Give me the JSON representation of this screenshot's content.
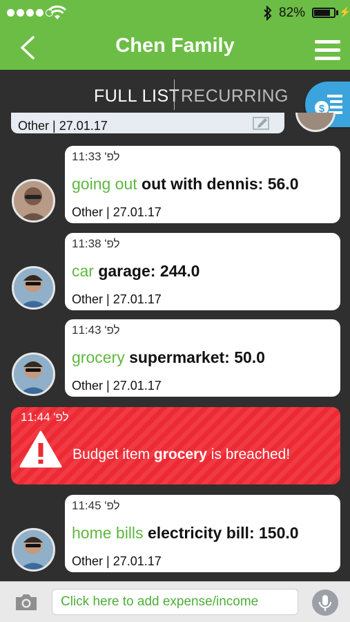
{
  "status_bar": {
    "battery": "82%",
    "battery_level": 0.82
  },
  "header": {
    "title": "Chen Family"
  },
  "tabs": [
    {
      "label": "FULL LIST"
    },
    {
      "label": "RECURRING"
    }
  ],
  "partial_entry": {
    "footer": "Other | 27.01.17"
  },
  "entries": [
    {
      "time": "לפ' 11:33",
      "category": "going out",
      "description": "out with dennis: 56.0",
      "footer": "Other | 27.01.17"
    },
    {
      "time": "לפ' 11:38",
      "category": "car",
      "description": "garage: 244.0",
      "footer": "Other | 27.01.17"
    },
    {
      "time": "לפ' 11:43",
      "category": "grocery",
      "description": "supermarket: 50.0",
      "footer": "Other | 27.01.17"
    },
    {
      "time": "לפ' 11:45",
      "category": "home bills",
      "description": "electricity bill: 150.0",
      "footer": "Other | 27.01.17"
    }
  ],
  "alert": {
    "time": "לפ' 11:44",
    "prefix": "Budget item ",
    "item": "grocery",
    "suffix": " is breached!"
  },
  "composer": {
    "placeholder": "Click here to add expense/income"
  },
  "colors": {
    "header": "#6cbd45",
    "category": "#5fb83f",
    "alert": "#ec2a34",
    "budget_button": "#3ba4dc"
  },
  "icons": [
    "back-icon",
    "menu-icon",
    "budget-icon",
    "edit-icon",
    "warning-icon",
    "camera-icon",
    "mic-icon"
  ]
}
